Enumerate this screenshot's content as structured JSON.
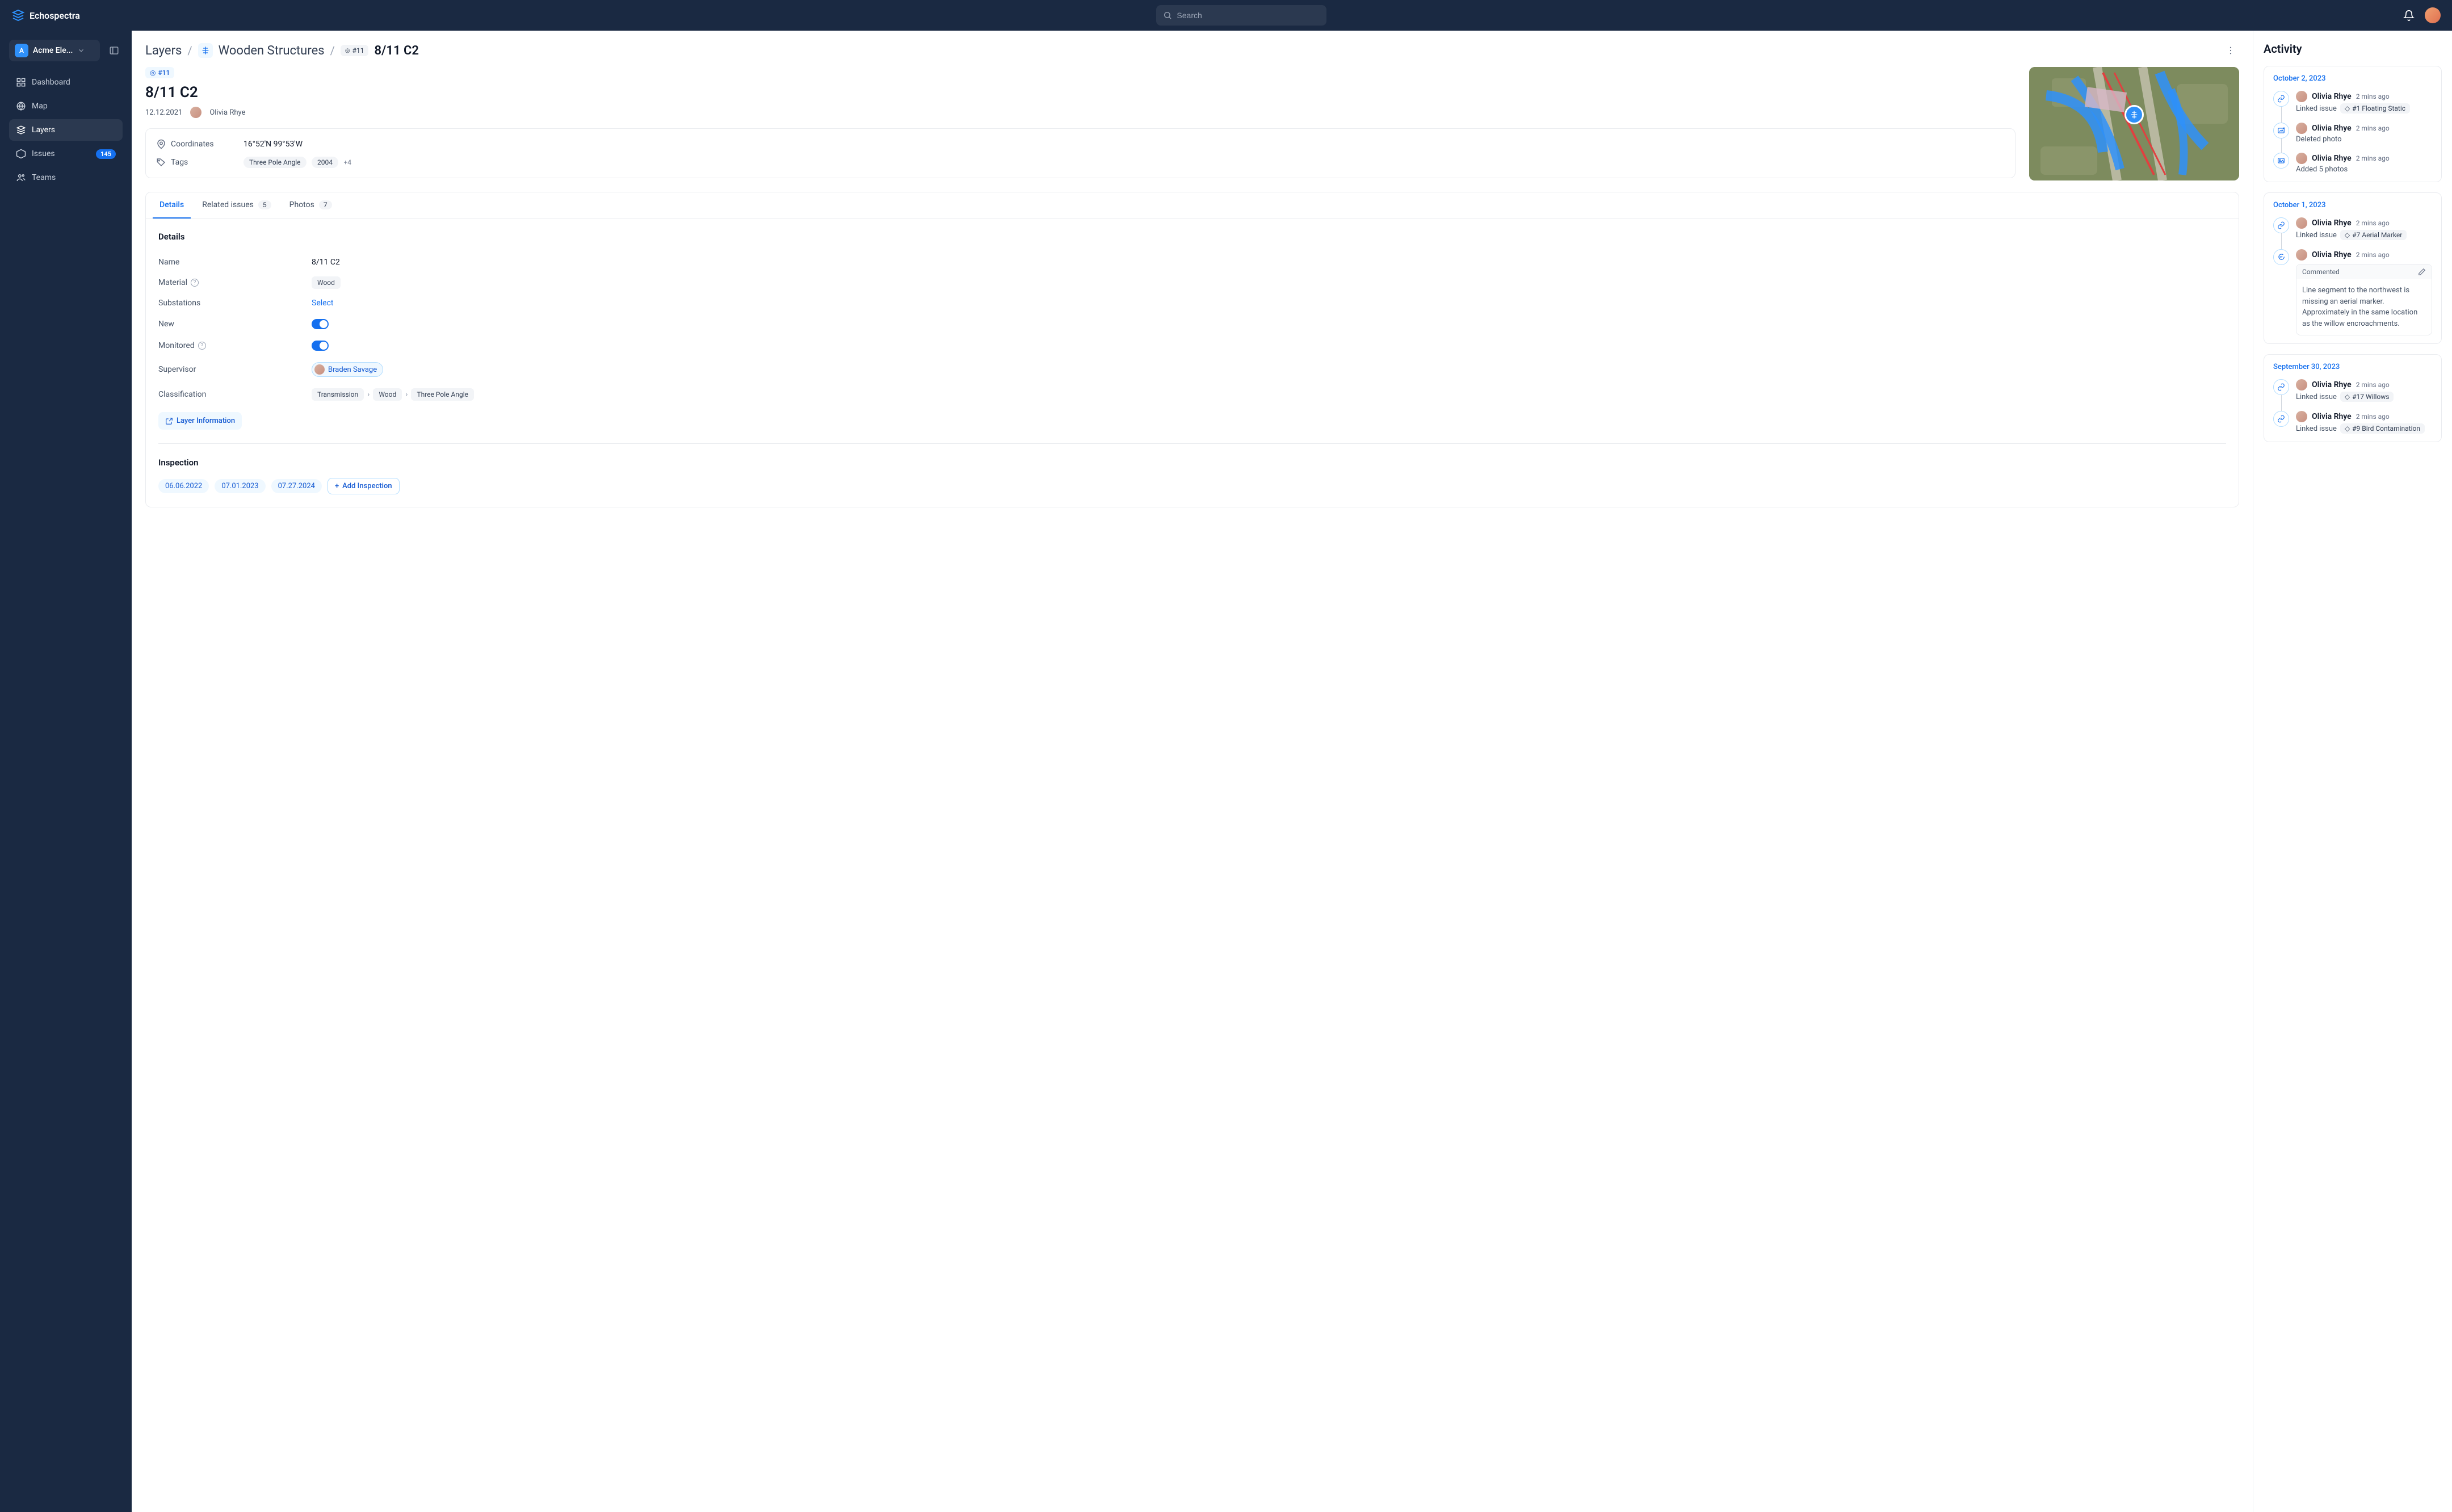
{
  "brand": "Echospectra",
  "search": {
    "placeholder": "Search"
  },
  "org": {
    "initial": "A",
    "name": "Acme Ele..."
  },
  "nav": {
    "dashboard": "Dashboard",
    "map": "Map",
    "layers": "Layers",
    "issues": "Issues",
    "issues_count": "145",
    "teams": "Teams"
  },
  "breadcrumbs": {
    "root": "Layers",
    "group": "Wooden Structures",
    "id_chip": "#11",
    "current": "8/11 C2"
  },
  "record": {
    "id_chip": "#11",
    "title": "8/11 C2",
    "date": "12.12.2021",
    "owner": "Olivia Rhye",
    "coordinates_label": "Coordinates",
    "coordinates": "16°52'N 99°53'W",
    "tags_label": "Tags",
    "tags": [
      "Three Pole Angle",
      "2004"
    ],
    "tags_more": "+4"
  },
  "tabs": {
    "details": "Details",
    "related": "Related issues",
    "related_count": "5",
    "photos": "Photos",
    "photos_count": "7"
  },
  "details": {
    "heading": "Details",
    "name_label": "Name",
    "name_value": "8/11 C2",
    "material_label": "Material",
    "material_value": "Wood",
    "substations_label": "Substations",
    "substations_value": "Select",
    "new_label": "New",
    "monitored_label": "Monitored",
    "supervisor_label": "Supervisor",
    "supervisor_value": "Braden Savage",
    "classification_label": "Classification",
    "classification_path": [
      "Transmission",
      "Wood",
      "Three Pole Angle"
    ],
    "layer_info_btn": "Layer Information"
  },
  "inspection": {
    "heading": "Inspection",
    "dates": [
      "06.06.2022",
      "07.01.2023",
      "07.27.2024"
    ],
    "add_btn": "Add Inspection"
  },
  "activity": {
    "heading": "Activity",
    "groups": [
      {
        "date": "October 2, 2023",
        "items": [
          {
            "icon": "link",
            "user": "Olivia Rhye",
            "time": "2 mins ago",
            "action": "Linked issue",
            "issue": "#1 Floating Static"
          },
          {
            "icon": "img-del",
            "user": "Olivia Rhye",
            "time": "2 mins ago",
            "action": "Deleted photo"
          },
          {
            "icon": "img",
            "user": "Olivia Rhye",
            "time": "2 mins ago",
            "action": "Added 5 photos"
          }
        ]
      },
      {
        "date": "October 1, 2023",
        "items": [
          {
            "icon": "link",
            "user": "Olivia Rhye",
            "time": "2 mins ago",
            "action": "Linked issue",
            "issue": "#7 Aerial Marker"
          },
          {
            "icon": "comment",
            "user": "Olivia Rhye",
            "time": "2 mins ago",
            "comment_label": "Commented",
            "comment": "Line segment to the northwest is missing an aerial marker. Approximately in the same location as the willow encroachments."
          }
        ]
      },
      {
        "date": "September 30, 2023",
        "items": [
          {
            "icon": "link",
            "user": "Olivia Rhye",
            "time": "2 mins ago",
            "action": "Linked issue",
            "issue": "#17 Willows"
          },
          {
            "icon": "link",
            "user": "Olivia Rhye",
            "time": "2 mins ago",
            "action": "Linked issue",
            "issue": "#9 Bird Contamination"
          }
        ]
      }
    ]
  }
}
